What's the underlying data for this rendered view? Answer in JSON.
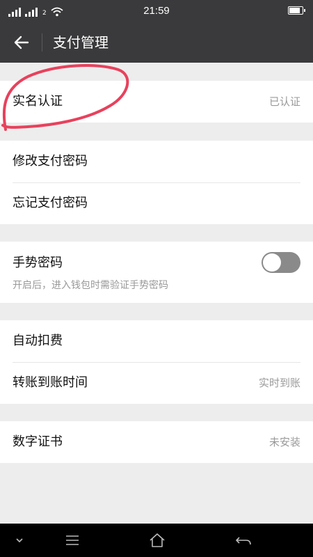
{
  "status_bar": {
    "time": "21:59",
    "sim_label": "2"
  },
  "header": {
    "title": "支付管理"
  },
  "groups": {
    "identity": {
      "label": "实名认证",
      "value": "已认证"
    },
    "password": {
      "change_label": "修改支付密码",
      "forgot_label": "忘记支付密码"
    },
    "gesture": {
      "label": "手势密码",
      "description": "开启后，进入钱包时需验证手势密码",
      "enabled": false
    },
    "payment": {
      "auto_deduct_label": "自动扣费",
      "transfer_time_label": "转账到账时间",
      "transfer_time_value": "实时到账"
    },
    "certificate": {
      "label": "数字证书",
      "value": "未安装"
    }
  },
  "colors": {
    "header_bg": "#3a3a3c",
    "annotation": "#e8415c",
    "toggle_off": "#8a8a8a"
  },
  "icons": [
    "back-arrow-icon",
    "wifi-icon",
    "battery-icon",
    "chevron-down-icon",
    "menu-icon",
    "home-icon",
    "back-icon"
  ]
}
